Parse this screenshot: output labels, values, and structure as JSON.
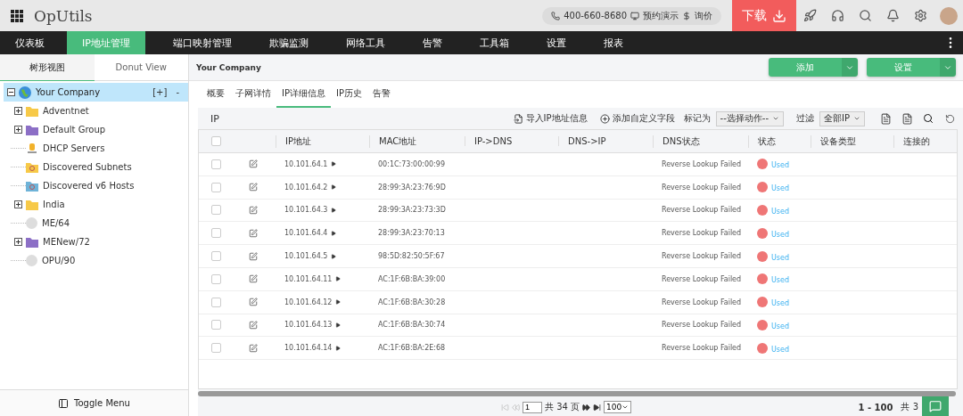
{
  "app": {
    "title": "OpUtils",
    "phone": "400-660-8680",
    "demo": "预约演示",
    "price": "询价",
    "download": "下载"
  },
  "nav": [
    {
      "label": "仪表板",
      "selected": false
    },
    {
      "label": "IP地址管理",
      "selected": true
    },
    {
      "label": "端口映射管理",
      "selected": false
    },
    {
      "label": "欺骗监测",
      "selected": false
    },
    {
      "label": "网络工具",
      "selected": false
    },
    {
      "label": "告警",
      "selected": false
    },
    {
      "label": "工具箱",
      "selected": false
    },
    {
      "label": "设置",
      "selected": false
    },
    {
      "label": "报表",
      "selected": false
    }
  ],
  "sidebar": {
    "tabs": [
      {
        "label": "树形视图",
        "selected": true
      },
      {
        "label": "Donut View",
        "selected": false
      }
    ],
    "root": {
      "label": "Your Company",
      "selected": true,
      "expanded": true,
      "add": "[+]",
      "remove": "-",
      "children": [
        {
          "label": "Adventnet",
          "kind": "folder",
          "expandable": true
        },
        {
          "label": "Default Group",
          "kind": "group",
          "expandable": true
        },
        {
          "label": "DHCP Servers",
          "kind": "dhcp",
          "expandable": false
        },
        {
          "label": "Discovered Subnets",
          "kind": "discovered",
          "expandable": false
        },
        {
          "label": "Discovered v6 Hosts",
          "kind": "discovered6",
          "expandable": false
        },
        {
          "label": "India",
          "kind": "folder",
          "expandable": true
        },
        {
          "label": "ME/64",
          "kind": "v6",
          "expandable": false
        },
        {
          "label": "MENew/72",
          "kind": "group",
          "expandable": true
        },
        {
          "label": "OPU/90",
          "kind": "v6",
          "expandable": false
        }
      ]
    },
    "toggle": "Toggle Menu"
  },
  "breadcrumb": "Your Company",
  "actions": [
    "添加",
    "设置"
  ],
  "tabs": [
    {
      "label": "概要",
      "selected": false
    },
    {
      "label": "子网详情",
      "selected": false
    },
    {
      "label": "IP详细信息",
      "selected": true
    },
    {
      "label": "IP历史",
      "selected": false
    },
    {
      "label": "告警",
      "selected": false
    }
  ],
  "toolbar": {
    "title": "IP",
    "import": "导入IP地址信息",
    "custom": "添加自定义字段",
    "mark_label": "标记为",
    "mark_value": "--选择动作--",
    "filter_label": "过滤",
    "filter_value": "全部IP"
  },
  "table": {
    "all_checked": false,
    "columns": [
      "IP地址",
      "MAC地址",
      "IP->DNS",
      "DNS->IP",
      "DNS状态",
      "状态",
      "设备类型",
      "连接的"
    ],
    "rows": [
      {
        "ip": "10.101.64.1",
        "mac": "00:1C:73:00:00:99",
        "dns_status": "Reverse Lookup Failed",
        "status": "Used",
        "color": "#ef7676",
        "checked": false
      },
      {
        "ip": "10.101.64.2",
        "mac": "28:99:3A:23:76:9D",
        "dns_status": "Reverse Lookup Failed",
        "status": "Used",
        "color": "#ef7676",
        "checked": false
      },
      {
        "ip": "10.101.64.3",
        "mac": "28:99:3A:23:73:3D",
        "dns_status": "Reverse Lookup Failed",
        "status": "Used",
        "color": "#ef7676",
        "checked": false
      },
      {
        "ip": "10.101.64.4",
        "mac": "28:99:3A:23:70:13",
        "dns_status": "Reverse Lookup Failed",
        "status": "Used",
        "color": "#ef7676",
        "checked": false
      },
      {
        "ip": "10.101.64.5",
        "mac": "98:5D:82:50:5F:67",
        "dns_status": "Reverse Lookup Failed",
        "status": "Used",
        "color": "#ef7676",
        "checked": false
      },
      {
        "ip": "10.101.64.11",
        "mac": "AC:1F:6B:BA:39:00",
        "dns_status": "Reverse Lookup Failed",
        "status": "Used",
        "color": "#ef7676",
        "checked": false
      },
      {
        "ip": "10.101.64.12",
        "mac": "AC:1F:6B:BA:30:28",
        "dns_status": "Reverse Lookup Failed",
        "status": "Used",
        "color": "#ef7676",
        "checked": false
      },
      {
        "ip": "10.101.64.13",
        "mac": "AC:1F:6B:BA:30:74",
        "dns_status": "Reverse Lookup Failed",
        "status": "Used",
        "color": "#ef7676",
        "checked": false
      },
      {
        "ip": "10.101.64.14",
        "mac": "AC:1F:6B:BA:2E:68",
        "dns_status": "Reverse Lookup Failed",
        "status": "Used",
        "color": "#ef7676",
        "checked": false
      }
    ]
  },
  "pager": {
    "page": "1",
    "of_pages": "共 34 页",
    "page_size": "100",
    "range": "1 - 100",
    "total": "共 3"
  }
}
